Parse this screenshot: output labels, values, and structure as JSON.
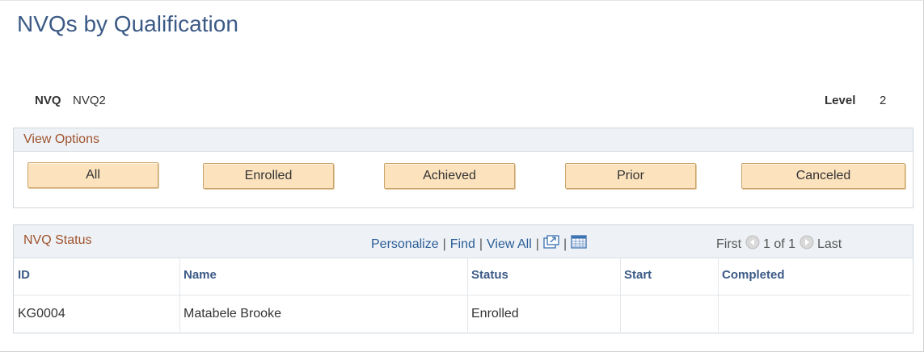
{
  "page": {
    "title": "NVQs by Qualification"
  },
  "fields": {
    "nvq_label": "NVQ",
    "nvq_value": "NVQ2",
    "level_label": "Level",
    "level_value": "2"
  },
  "view_options": {
    "title": "View Options",
    "buttons": [
      "All",
      "Enrolled",
      "Achieved",
      "Prior",
      "Canceled"
    ]
  },
  "grid": {
    "title": "NVQ Status",
    "toolbar": {
      "personalize": "Personalize",
      "find": "Find",
      "view_all": "View All",
      "first": "First",
      "range": "1 of 1",
      "last": "Last"
    },
    "columns": [
      "ID",
      "Name",
      "Status",
      "Start",
      "Completed"
    ],
    "rows": [
      [
        "KG0004",
        "Matabele Brooke",
        "Enrolled",
        "",
        ""
      ]
    ]
  },
  "colors": {
    "title": "#3c5a86",
    "group_title": "#a0522d",
    "link": "#2b5d97",
    "button_bg": "#fce3bd"
  },
  "icons": [
    "new-window-icon",
    "download-spreadsheet-icon",
    "previous-page-icon",
    "next-page-icon"
  ]
}
